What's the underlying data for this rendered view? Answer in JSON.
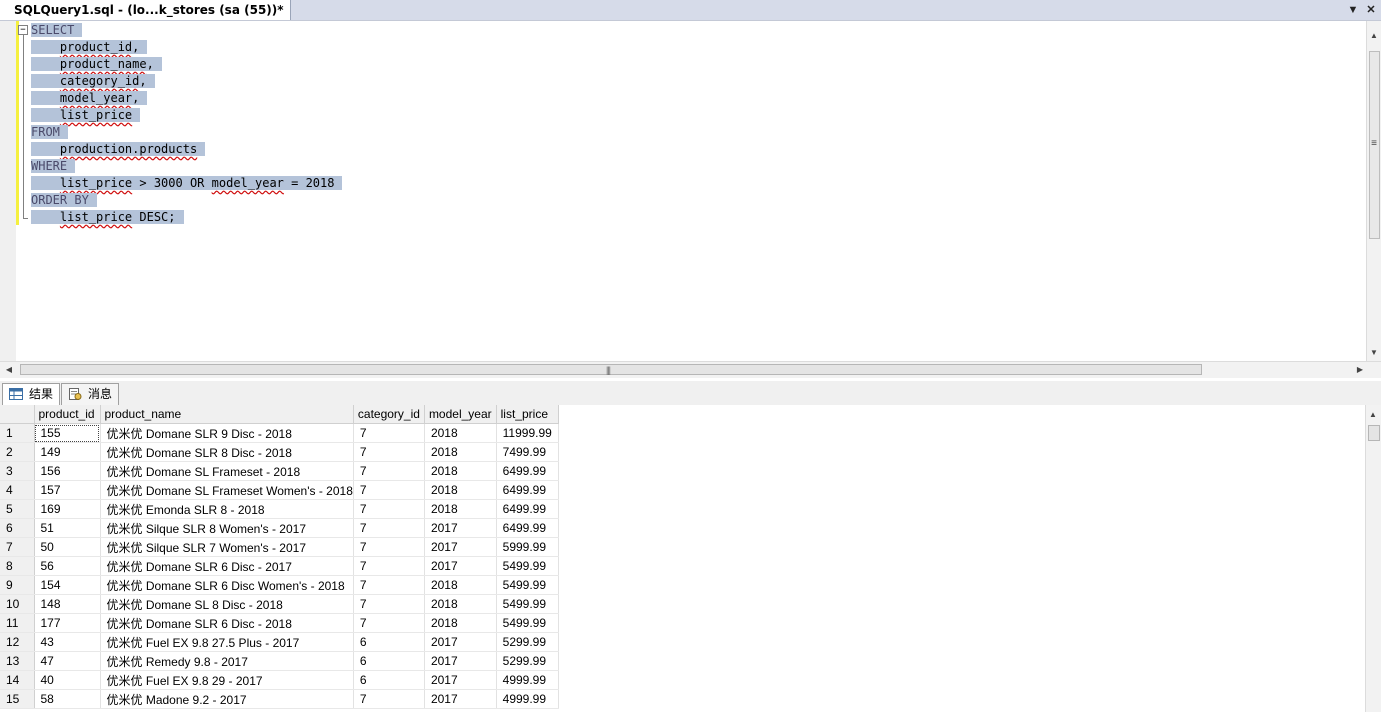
{
  "tab": {
    "title": "SQLQuery1.sql - (lo...k_stores (sa (55))*"
  },
  "editor": {
    "lines": [
      {
        "indent": "",
        "parts": [
          {
            "t": "SELECT",
            "c": "kw"
          }
        ]
      },
      {
        "indent": "    ",
        "parts": [
          {
            "t": "product_id",
            "c": "sq"
          },
          {
            "t": ",",
            "c": ""
          }
        ]
      },
      {
        "indent": "    ",
        "parts": [
          {
            "t": "product_name",
            "c": "sq"
          },
          {
            "t": ",",
            "c": ""
          }
        ]
      },
      {
        "indent": "    ",
        "parts": [
          {
            "t": "category_id",
            "c": "sq"
          },
          {
            "t": ",",
            "c": ""
          }
        ]
      },
      {
        "indent": "    ",
        "parts": [
          {
            "t": "model_year",
            "c": "sq"
          },
          {
            "t": ",",
            "c": ""
          }
        ]
      },
      {
        "indent": "    ",
        "parts": [
          {
            "t": "list_price",
            "c": "sq"
          }
        ]
      },
      {
        "indent": "",
        "parts": [
          {
            "t": "FROM",
            "c": "kw"
          }
        ]
      },
      {
        "indent": "    ",
        "parts": [
          {
            "t": "production.products",
            "c": "sq"
          }
        ]
      },
      {
        "indent": "",
        "parts": [
          {
            "t": "WHERE",
            "c": "kw"
          }
        ]
      },
      {
        "indent": "    ",
        "parts": [
          {
            "t": "list_price",
            "c": "sq"
          },
          {
            "t": " > 3000 OR ",
            "c": ""
          },
          {
            "t": "model_year",
            "c": "sq"
          },
          {
            "t": " = 2018",
            "c": ""
          }
        ]
      },
      {
        "indent": "",
        "parts": [
          {
            "t": "ORDER BY",
            "c": "kw"
          }
        ]
      },
      {
        "indent": "    ",
        "parts": [
          {
            "t": "list_price",
            "c": "sq"
          },
          {
            "t": " DESC;",
            "c": ""
          }
        ]
      }
    ]
  },
  "results_tabs": [
    {
      "label": "结果",
      "icon": "grid-icon"
    },
    {
      "label": "消息",
      "icon": "message-icon"
    }
  ],
  "grid": {
    "columns": [
      "product_id",
      "product_name",
      "category_id",
      "model_year",
      "list_price"
    ],
    "rows": [
      [
        "1",
        "155",
        "优米优 Domane SLR 9 Disc - 2018",
        "7",
        "2018",
        "11999.99"
      ],
      [
        "2",
        "149",
        "优米优 Domane SLR 8 Disc - 2018",
        "7",
        "2018",
        "7499.99"
      ],
      [
        "3",
        "156",
        "优米优 Domane SL Frameset - 2018",
        "7",
        "2018",
        "6499.99"
      ],
      [
        "4",
        "157",
        "优米优 Domane SL Frameset Women's - 2018",
        "7",
        "2018",
        "6499.99"
      ],
      [
        "5",
        "169",
        "优米优 Emonda SLR 8 - 2018",
        "7",
        "2018",
        "6499.99"
      ],
      [
        "6",
        "51",
        "优米优 Silque SLR 8 Women's - 2017",
        "7",
        "2017",
        "6499.99"
      ],
      [
        "7",
        "50",
        "优米优 Silque SLR 7 Women's - 2017",
        "7",
        "2017",
        "5999.99"
      ],
      [
        "8",
        "56",
        "优米优 Domane SLR 6 Disc - 2017",
        "7",
        "2017",
        "5499.99"
      ],
      [
        "9",
        "154",
        "优米优 Domane SLR 6 Disc Women's - 2018",
        "7",
        "2018",
        "5499.99"
      ],
      [
        "10",
        "148",
        "优米优 Domane SL 8 Disc - 2018",
        "7",
        "2018",
        "5499.99"
      ],
      [
        "11",
        "177",
        "优米优 Domane SLR 6 Disc - 2018",
        "7",
        "2018",
        "5499.99"
      ],
      [
        "12",
        "43",
        "优米优 Fuel EX 9.8 27.5 Plus - 2017",
        "6",
        "2017",
        "5299.99"
      ],
      [
        "13",
        "47",
        "优米优 Remedy 9.8 - 2017",
        "6",
        "2017",
        "5299.99"
      ],
      [
        "14",
        "40",
        "优米优 Fuel EX 9.8 29 - 2017",
        "6",
        "2017",
        "4999.99"
      ],
      [
        "15",
        "58",
        "优米优 Madone 9.2 - 2017",
        "7",
        "2017",
        "4999.99"
      ]
    ]
  }
}
